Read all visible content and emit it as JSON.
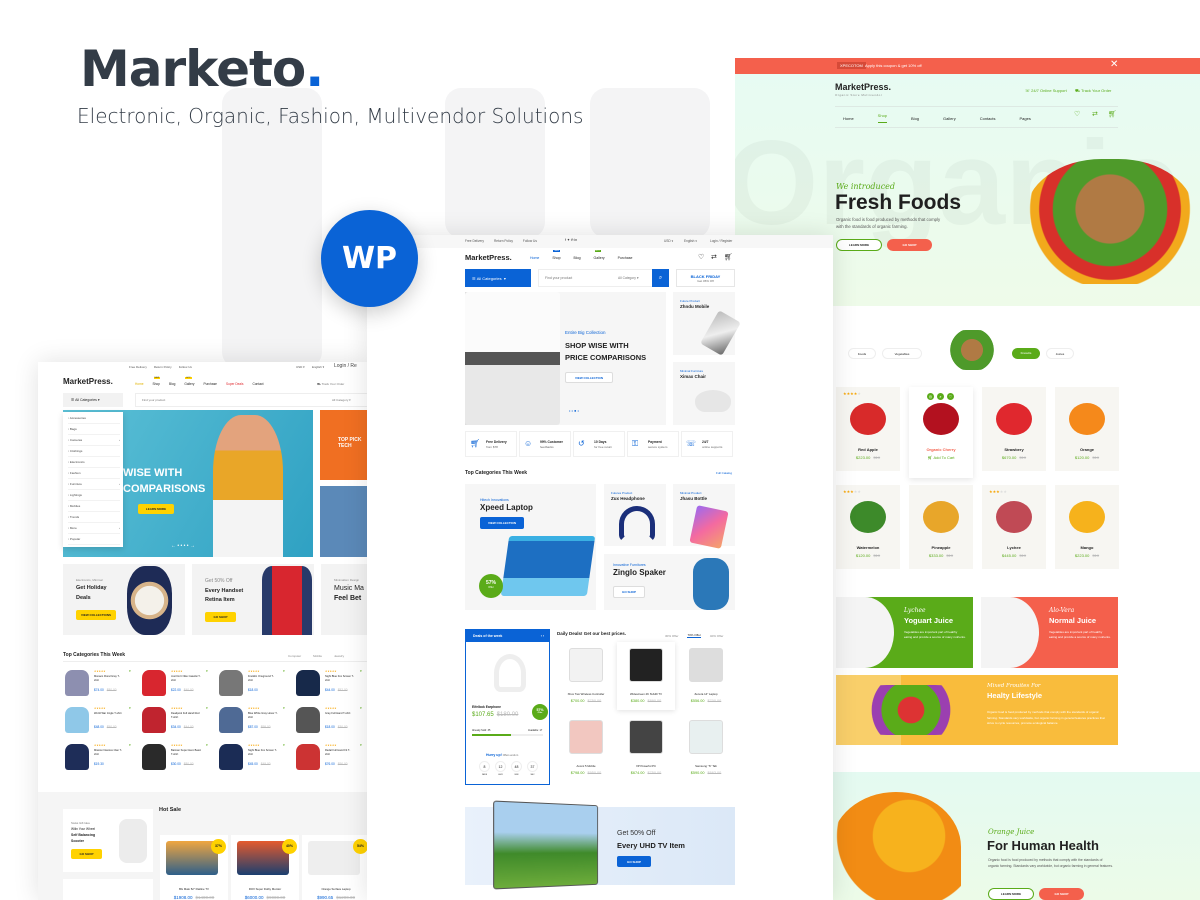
{
  "brand": {
    "title": "Marketo",
    "dot": ".",
    "subtitle": "Electronic, Organic, Fashion, Multivendor Solutions"
  },
  "wp_badge": "WP",
  "colors": {
    "brand_blue": "#0a63d6",
    "organic_green": "#5aab19",
    "coral": "#f25f4c",
    "yellow": "#ffd200"
  },
  "center": {
    "topbar": {
      "items": [
        "Free Delivery",
        "Return Policy",
        "Follow Us"
      ],
      "currency": "USD",
      "language": "English",
      "login": "Login / Register"
    },
    "logo": "MarketPress.",
    "nav": [
      {
        "label": "Home"
      },
      {
        "label": "Shop",
        "badge": "NEW"
      },
      {
        "label": "Blog"
      },
      {
        "label": "Gallery",
        "badge": "HOT"
      },
      {
        "label": "Purchase"
      }
    ],
    "all_categories": "All Categories",
    "search_placeholder": "Find your product",
    "category_select": "All Category",
    "black_friday": {
      "title": "BLACK FRIDAY",
      "sub": "Get 45% Off"
    },
    "hero": {
      "tag": "Entire Big Collection",
      "line1": "SHOP WISE WITH",
      "line2": "PRICE COMPARISONS",
      "button": "VIEW COLLECTION"
    },
    "side_promos": [
      {
        "tag": "Future Product",
        "title": "Zhndu Mobile"
      },
      {
        "tag": "Minimal Furniture",
        "title": "Ximax Chair"
      }
    ],
    "features": [
      {
        "title": "Free Delivery",
        "sub": "from $78"
      },
      {
        "title": "99% Customer",
        "sub": "feedbacks"
      },
      {
        "title": "10 Days",
        "sub": "for free return"
      },
      {
        "title": "Payment",
        "sub": "secure system"
      },
      {
        "title": "24/7",
        "sub": "online supports"
      }
    ],
    "top_categories": {
      "title": "Top Categories This Week",
      "link": "Full Catalog",
      "laptop": {
        "tag": "Hitech Innovations",
        "title": "Xpeed Laptop",
        "button": "VIEW COLLECTION",
        "discount": "57%",
        "discount_sub": "Offer"
      },
      "headphone": {
        "tag": "Futures Product",
        "title": "Zux Headphone"
      },
      "bottle": {
        "tag": "Minimal Product",
        "title": "Jhasu Bottle"
      },
      "speaker": {
        "tag": "Innovative Furnitures",
        "title": "Zinglo Spaker",
        "button": "GO SHOP"
      }
    },
    "deal": {
      "header": "Deals of the week",
      "product": "Eifelbok Earphone",
      "price": "$107.65",
      "old_price": "$180.00",
      "discount": "57%",
      "discount_sub": "Offer",
      "sold": "Already Sold: 35",
      "available": "Available: 17",
      "sold_fraction": 0.55,
      "hurry": "Hurry up!",
      "offer_ends": "Offers ends in",
      "countdown": [
        {
          "v": "8",
          "l": "DAYS"
        },
        {
          "v": "12",
          "l": "HUR"
        },
        {
          "v": "48",
          "l": "MIN"
        },
        {
          "v": "37",
          "l": "SEC"
        }
      ]
    },
    "daily": {
      "title": "Daily Deals! Get our best prices.",
      "tabs": [
        "30% Offer",
        "70% Offer",
        "40% Offer"
      ],
      "active_tab": 1,
      "products": [
        {
          "name": "Xbox Two Wireless Controller",
          "price": "$700.00",
          "old": "$750.00"
        },
        {
          "name": "Widescreen 4K SUHD TV",
          "price": "$380.00",
          "old": "$890.00"
        },
        {
          "name": "Zenora 14\" Laptop",
          "price": "$556.00",
          "old": "$700.00"
        },
        {
          "name": "Axomi 5 Mobile",
          "price": "$798.00",
          "old": "$950.00"
        },
        {
          "name": "XP Powerful PC",
          "price": "$674.00",
          "old": "$750.00"
        },
        {
          "name": "Samsung \"S\" Tab",
          "price": "$590.00",
          "old": "$663.00"
        }
      ]
    },
    "uhd": {
      "line1": "Get 50% Off",
      "line2": "Every UHD TV Item",
      "button": "GO SHOP"
    }
  },
  "right": {
    "coupon": {
      "code": "XPECOTOM",
      "text": "Apply this coupon & get 10% off"
    },
    "logo": "MarketPress.",
    "logo_sub": "Organic Store Multivendor",
    "support": "24/7 Online Support",
    "track": "Track Your Order",
    "nav": [
      "Home",
      "Shop",
      "Blog",
      "Gallery",
      "Contacts",
      "Pages"
    ],
    "active_nav": 1,
    "counts": [
      "0",
      "0",
      "0"
    ],
    "hero": {
      "script": "We introduced",
      "title": "Fresh Foods",
      "desc1": "Organic food is food produced by methods that comply",
      "desc2": "with the standards of organic farming.",
      "learn": "LEARN MORE",
      "shop": "GO SHOP",
      "watermark": "Organic"
    },
    "tabs": [
      "Foods",
      "Vegetables",
      "Fresults",
      "Juices"
    ],
    "active_tab": 2,
    "products": [
      {
        "name": "Red Apple",
        "price": "$223.00",
        "old": "$10",
        "stars": 4
      },
      {
        "name": "Organic Cherry",
        "action": "Add To Cart",
        "highlight": true
      },
      {
        "name": "Strawbery",
        "price": "$670.00",
        "old": "$10"
      },
      {
        "name": "Orange",
        "price": "$120.00",
        "old": "$10"
      },
      {
        "name": "Watermelon",
        "price": "$120.00",
        "old": "$10",
        "stars": 3
      },
      {
        "name": "Pineapple",
        "price": "$333.00",
        "old": "$10"
      },
      {
        "name": "Lychee",
        "price": "$445.00",
        "old": "$10",
        "stars": 3
      },
      {
        "name": "Mango",
        "price": "$223.00",
        "old": "$10"
      }
    ],
    "juice1": {
      "script": "Lychee",
      "title": "Yoguart Juice",
      "desc": "Vegetables are important part of healthy eating and provide a source of many nutrients."
    },
    "juice2": {
      "script": "Alo-Vera",
      "title": "Normal Juice",
      "desc": "Vegetables are important part of healthy eating and provide a source of many nutrients."
    },
    "mixed": {
      "script": "Mixed Frouites For",
      "title": "Healty Lifestyle",
      "desc": "Organic food is food produced by methods that comply with the standards of organic farming. Standards vary worldwide, but organic farming in general features practices that strive to cycle resources, promote ecological balance."
    },
    "orange": {
      "script": "Orange Juice",
      "title": "For Human Health",
      "desc": "Organic food is food produced by methods that comply with the standards of organic farming. Standards vary worldwide, but organic farming in general features.",
      "learn": "LEARN MORE",
      "shop": "GO SHOP"
    }
  },
  "left": {
    "topbar": [
      "Free Delivery",
      "Return Policy",
      "Follow Us"
    ],
    "currency": "USD",
    "language": "English",
    "login": "Login / Re",
    "logo": "MarketPress.",
    "nav": [
      {
        "label": "Home"
      },
      {
        "label": "Shop",
        "badge": "NEW"
      },
      {
        "label": "Blog"
      },
      {
        "label": "Gallery",
        "badge": "HOT"
      },
      {
        "label": "Purchase"
      },
      {
        "label": "Super Deals"
      },
      {
        "label": "Contact"
      }
    ],
    "track": "Track Your Order",
    "all_categories": "All Categories",
    "search_placeholder": "Find your product",
    "category_select": "All Category",
    "categories": [
      "Accessories",
      "Bags",
      "Cameras",
      "Clothings",
      "Electronics",
      "Fashion",
      "Furniture",
      "Lightings",
      "Mobiles",
      "Trends",
      "More",
      "Popular"
    ],
    "hero": {
      "line1": "WISE WITH",
      "line2": "COMPARISONS",
      "button": "LEARN MORE"
    },
    "side": "TOP PICK TECH",
    "promos": [
      {
        "tag": "Electronics, Minimal",
        "title1": "Get Holiday",
        "title2": "Deals",
        "button": "VIEW COLLECTIONS"
      },
      {
        "tag": "Get 50% Off",
        "title1": "Every Handset",
        "title2": "Retina Item",
        "button": "GO SHOP"
      },
      {
        "tag": "Minimalism Design",
        "title1": "Music Ma",
        "title2": "Feel Bet"
      }
    ],
    "top_categories": "Top Categories This Week",
    "tabs": [
      "Computer",
      "Mobile",
      "Jewelry"
    ],
    "products": [
      {
        "name": "Monaco Floral Gray T-shirt",
        "price": "$74.00",
        "old": "$80.00"
      },
      {
        "name": "Just Do It Nike Casefat T-shirt",
        "price": "$22.00",
        "old": "$40.00"
      },
      {
        "name": "Franklin Onsground T-shirt",
        "price": "$18.00"
      },
      {
        "name": "Night Blue Fox Screen T-shirt",
        "price": "$44.00",
        "old": "$52.00"
      },
      {
        "name": "World War Jingle T-shirt",
        "price": "$48.00",
        "old": "$50.00"
      },
      {
        "name": "Deadpool Full Hand Red T-shirt",
        "price": "$34.00",
        "old": "$44.00"
      },
      {
        "name": "Blue White Gray Hover T-shirt",
        "price": "$87.00",
        "old": "$99.00"
      },
      {
        "name": "Gray Full Hand T-shirt",
        "price": "$18.00",
        "old": "$30.00"
      },
      {
        "name": "Mission Navioce Clan T-shirt",
        "price": "$19.30"
      },
      {
        "name": "Batman Super Hero Basic T-shirt",
        "price": "$30.00",
        "old": "$80.00"
      },
      {
        "name": "Night Blue Fox Screen T-shirt",
        "price": "$45.00",
        "old": "$49.00"
      },
      {
        "name": "Redal Full Hand Fit T-shirt",
        "price": "$76.00",
        "old": "$90.00"
      }
    ],
    "hot_sale": {
      "title": "Hot Sale",
      "promo_tag": "Swiss Gift Idea",
      "promo_l1": "Wiiin Your Wheel",
      "promo_l2": "Self Balancing",
      "promo_l3": "Scooter",
      "promo_btn": "GO SHOP",
      "items": [
        {
          "name": "BG Malo 52\" Flatline TV",
          "price": "$1908.00",
          "old": "$1400.00",
          "discount": "37%"
        },
        {
          "name": "ROX Super Dolby Monitor",
          "price": "$6000.00",
          "old": "$9000.00",
          "discount": "40%"
        },
        {
          "name": "Orange Surface Laptop",
          "price": "$990.65",
          "old": "$1200.00",
          "discount": "54%"
        }
      ]
    }
  }
}
